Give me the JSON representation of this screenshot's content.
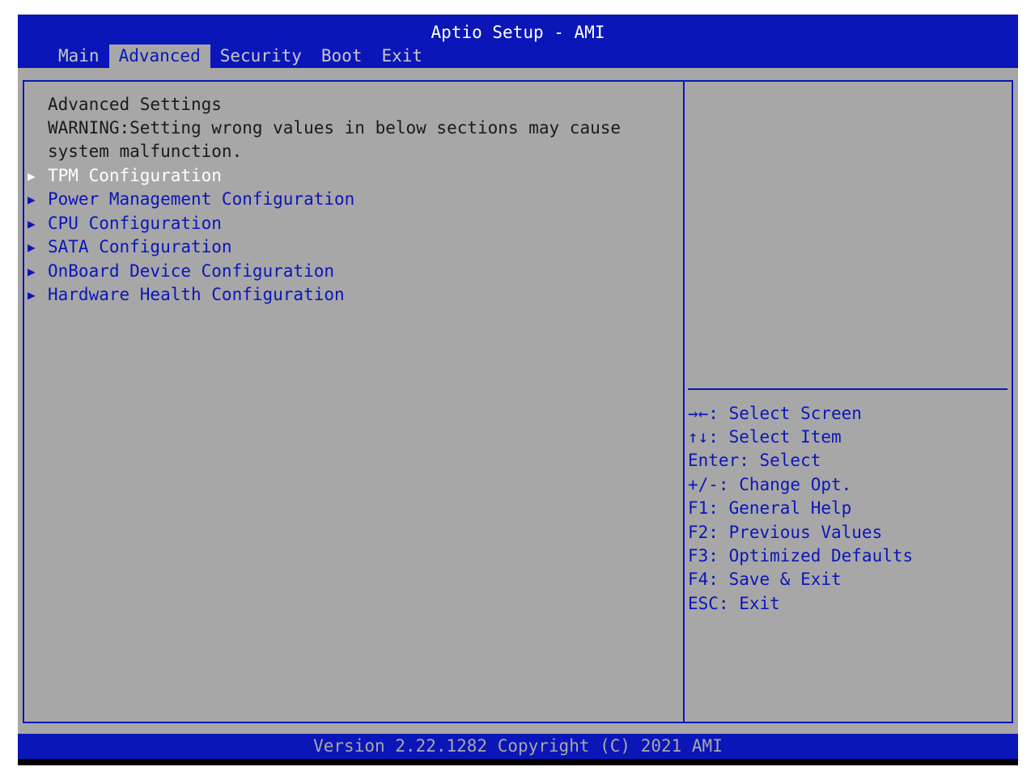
{
  "header": {
    "title": "Aptio Setup - AMI",
    "tabs": [
      "Main",
      "Advanced",
      "Security",
      "Boot",
      "Exit"
    ],
    "active_tab": "Advanced"
  },
  "main": {
    "heading": "Advanced Settings",
    "warning_line1": "WARNING:Setting wrong values in below sections may cause",
    "warning_line2": "system malfunction.",
    "items": [
      "TPM Configuration",
      "Power Management Configuration",
      "CPU Configuration",
      "SATA Configuration",
      "OnBoard Device Configuration",
      "Hardware Health Configuration"
    ],
    "selected_item": "TPM Configuration"
  },
  "help": {
    "keys": [
      "→←: Select Screen",
      "↑↓: Select Item",
      "Enter: Select",
      "+/-: Change Opt.",
      "F1: General Help",
      "F2: Previous Values",
      "F3: Optimized Defaults",
      "F4: Save & Exit",
      "ESC: Exit"
    ]
  },
  "footer": {
    "text": "Version 2.22.1282 Copyright (C) 2021 AMI"
  },
  "colors": {
    "bios_blue": "#0b16b8",
    "panel_gray": "#a7a7a7",
    "selected_text": "#ffffff"
  }
}
